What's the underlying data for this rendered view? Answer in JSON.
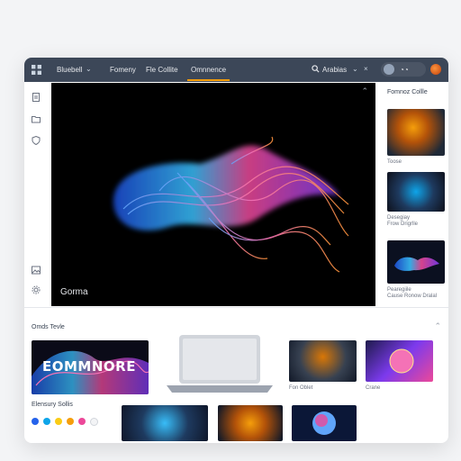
{
  "topbar": {
    "title": "Bluebell",
    "nav": [
      "Fomeny",
      "Fle Collite",
      "Omnnence"
    ],
    "search": "Arabias"
  },
  "canvas": {
    "caption": "Gorma"
  },
  "right_panel": {
    "title": "Fomnoz Collle",
    "items": [
      "Toose",
      "Desegiay\nFrow Drigrlle",
      "Pearegiile\nCause Ronow Dralal"
    ]
  },
  "bottom": {
    "title": "Omds Tevle",
    "hero_text": "EOMMNORE",
    "color_label": "Elensury Sollis",
    "captions": [
      "Fon Oblet",
      "Crane"
    ]
  },
  "colors": {
    "topbar": "#3c4758",
    "accent": "#f59e0b",
    "swatches": [
      "#2563eb",
      "#0ea5e9",
      "#facc15",
      "#f59e0b",
      "#ec4899",
      "#f3f4f6"
    ]
  }
}
